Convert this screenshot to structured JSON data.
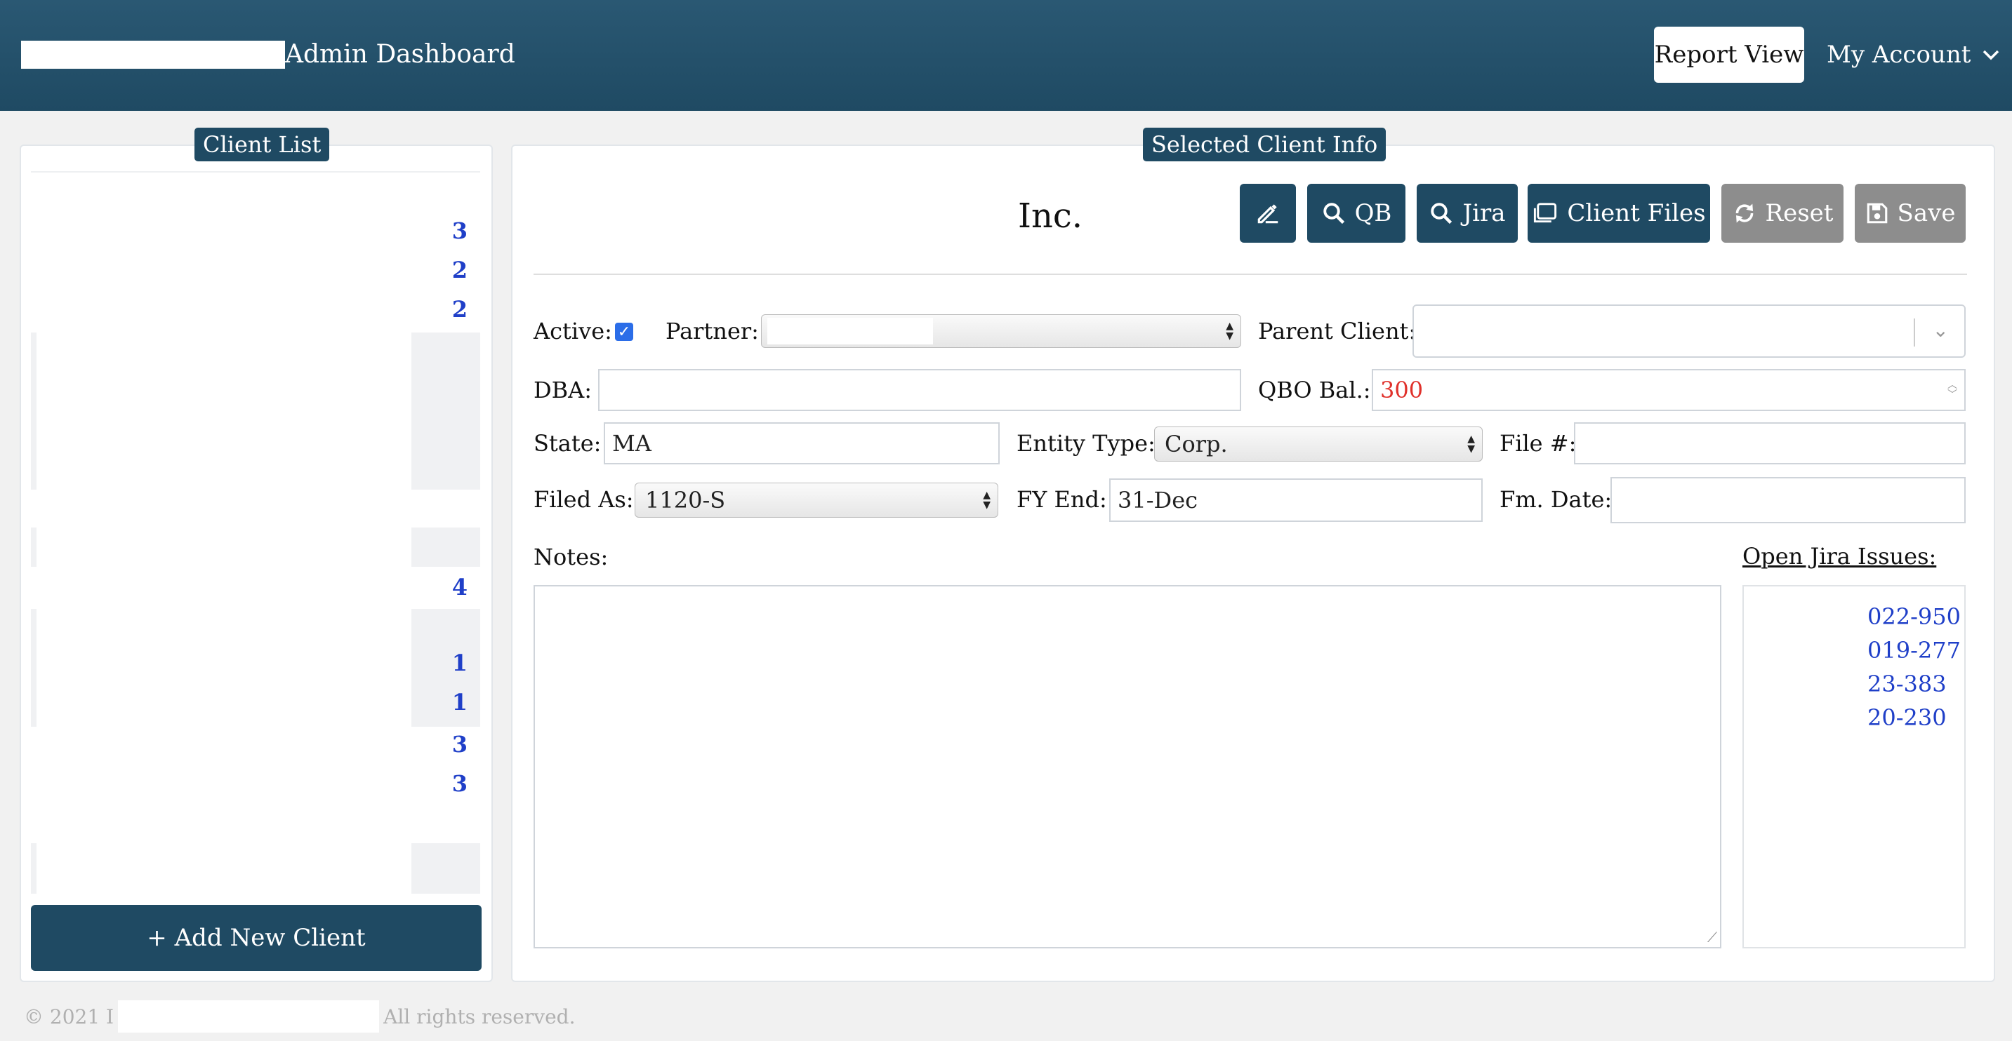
{
  "header": {
    "title": "Admin Dashboard",
    "report_view": "Report View",
    "my_account": "My Account"
  },
  "client_list": {
    "title": "Client List",
    "counts": [
      "3",
      "2",
      "2",
      "4",
      "1",
      "1",
      "3",
      "3"
    ],
    "add_button": "+ Add New Client"
  },
  "selected_client": {
    "title": "Selected Client Info",
    "name": "Inc.",
    "toolbar": {
      "qb": "QB",
      "jira": "Jira",
      "client_files": "Client Files",
      "reset": "Reset",
      "save": "Save"
    },
    "form": {
      "active_label": "Active:",
      "active_checked": true,
      "partner_label": "Partner:",
      "parent_client_label": "Parent Client:",
      "dba_label": "DBA:",
      "dba_value": "",
      "qbo_bal_label": "QBO Bal.:",
      "qbo_bal_value": "300",
      "state_label": "State:",
      "state_value": "MA",
      "entity_type_label": "Entity Type:",
      "entity_type_value": "Corp.",
      "file_no_label": "File #:",
      "file_no_value": "",
      "filed_as_label": "Filed As:",
      "filed_as_value": "1120-S",
      "fy_end_label": "FY End:",
      "fy_end_value": "31-Dec",
      "fm_date_label": "Fm. Date:",
      "fm_date_value": "",
      "notes_label": "Notes:",
      "notes_value": ""
    },
    "jira": {
      "title": "Open Jira Issues:",
      "issues": [
        "022-950",
        "019-277",
        "23-383",
        "20-230"
      ]
    }
  },
  "footer": {
    "copyright": "© 2021 I",
    "rights": "All rights reserved."
  },
  "colors": {
    "header_bg": "#1f4a63",
    "accent_blue": "#1f3fc8",
    "qbo_red": "#e0312b",
    "disabled_grey": "#8d8d8d"
  }
}
